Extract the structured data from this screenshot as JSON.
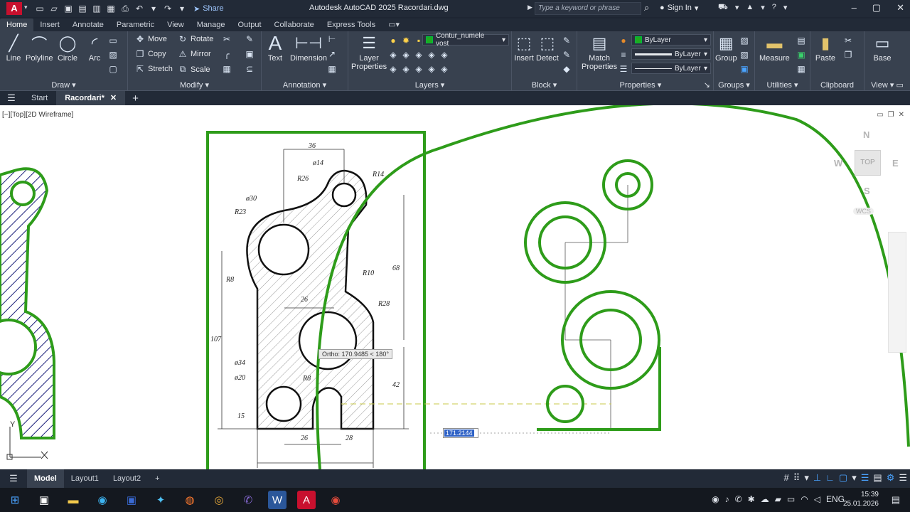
{
  "titlebar": {
    "logo": "A",
    "share_label": "Share",
    "doc_title": "Autodesk AutoCAD 2025   Racordari.dwg",
    "search_placeholder": "Type a keyword or phrase",
    "signin_label": "Sign In"
  },
  "menu_tabs": [
    "Home",
    "Insert",
    "Annotate",
    "Parametric",
    "View",
    "Manage",
    "Output",
    "Collaborate",
    "Express Tools"
  ],
  "ribbon": {
    "draw": {
      "title": "Draw",
      "line": "Line",
      "polyline": "Polyline",
      "circle": "Circle",
      "arc": "Arc"
    },
    "modify": {
      "title": "Modify",
      "move": "Move",
      "rotate": "Rotate",
      "copy": "Copy",
      "mirror": "Mirror",
      "stretch": "Stretch",
      "scale": "Scale"
    },
    "annotation": {
      "title": "Annotation",
      "text": "Text",
      "dimension": "Dimension"
    },
    "layers": {
      "title": "Layers",
      "layer_properties_1": "Layer",
      "layer_properties_2": "Properties",
      "current_layer": "Contur_numele vost"
    },
    "block": {
      "title": "Block",
      "insert": "Insert",
      "detect": "Detect"
    },
    "properties": {
      "title": "Properties",
      "match_1": "Match",
      "match_2": "Properties",
      "color": "ByLayer",
      "lineweight": "ByLayer",
      "linetype": "ByLayer"
    },
    "groups": {
      "title": "Groups",
      "group": "Group"
    },
    "utilities": {
      "title": "Utilities",
      "measure": "Measure"
    },
    "clipboard": {
      "title": "Clipboard",
      "paste": "Paste"
    },
    "view": {
      "title": "View",
      "base": "Base"
    }
  },
  "file_tabs": {
    "start": "Start",
    "current": "Racordari*"
  },
  "viewport": {
    "label": "[−][Top][2D Wireframe]",
    "cube": {
      "n": "N",
      "s": "S",
      "e": "E",
      "w": "W",
      "top": "TOP",
      "wcs": "WCS"
    },
    "ucs_y": "Y",
    "tooltip": "Ortho: 170.9485 < 180°",
    "dyn_input_value": "171.2144"
  },
  "drawing_dims": {
    "d36": "36",
    "d14": "ø14",
    "r14": "R14",
    "r26": "R26",
    "d30": "ø30",
    "r23": "R23",
    "r8": "R8",
    "r10": "R10",
    "r28": "R28",
    "d26": "26",
    "h68": "68",
    "h107": "107",
    "d34": "ø34",
    "d20": "ø20",
    "h42": "42",
    "d26b": "26",
    "d28": "28",
    "h15": "15",
    "r8b": "R8"
  },
  "layout_tabs": [
    "Model",
    "Layout1",
    "Layout2"
  ],
  "taskbar": {
    "lang": "ENG",
    "time": "15:39",
    "date": "25.01.2026"
  },
  "colors": {
    "green": "#2e9c1a",
    "ribbon": "#38414f",
    "titlebar": "#222a37",
    "accent": "#4aa3ff"
  }
}
